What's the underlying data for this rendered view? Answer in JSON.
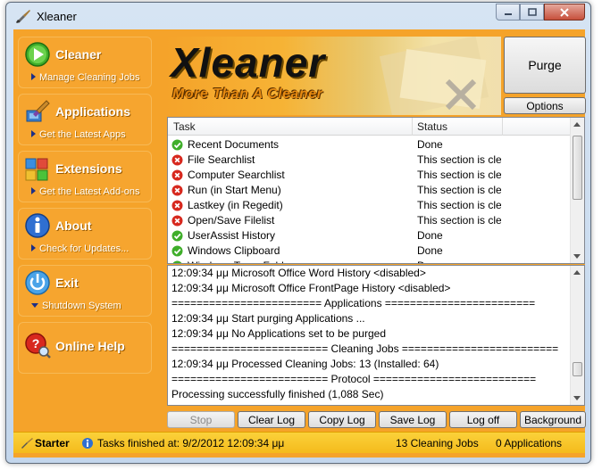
{
  "window": {
    "title": "Xleaner"
  },
  "sidebar": {
    "items": [
      {
        "title": "Cleaner",
        "sub": "Manage Cleaning Jobs",
        "icon": "play-icon"
      },
      {
        "title": "Applications",
        "sub": "Get the Latest Apps",
        "icon": "brush-icon"
      },
      {
        "title": "Extensions",
        "sub": "Get the Latest Add-ons",
        "icon": "cubes-icon"
      },
      {
        "title": "About",
        "sub": "Check for Updates...",
        "icon": "info-icon"
      },
      {
        "title": "Exit",
        "sub": "Shutdown System",
        "icon": "power-icon"
      },
      {
        "title": "Online Help",
        "sub": "",
        "icon": "help-icon"
      }
    ]
  },
  "banner": {
    "title": "Xleaner",
    "subtitle": "More Than A Cleaner"
  },
  "actions": {
    "purge": "Purge",
    "options": "Options"
  },
  "task_table": {
    "columns": [
      "Task",
      "Status"
    ],
    "rows": [
      {
        "task": "Recent Documents",
        "status": "Done",
        "state": "ok"
      },
      {
        "task": "File Searchlist",
        "status": "This section is clear",
        "state": "error"
      },
      {
        "task": "Computer Searchlist",
        "status": "This section is clear",
        "state": "error"
      },
      {
        "task": "Run (in Start Menu)",
        "status": "This section is clear",
        "state": "error"
      },
      {
        "task": "Lastkey (in Regedit)",
        "status": "This section is clear",
        "state": "error"
      },
      {
        "task": "Open/Save Filelist",
        "status": "This section is clear",
        "state": "error"
      },
      {
        "task": "UserAssist History",
        "status": "Done",
        "state": "ok"
      },
      {
        "task": "Windows Clipboard",
        "status": "Done",
        "state": "ok"
      },
      {
        "task": "Windows Temp Folder",
        "status": "Done",
        "state": "ok"
      }
    ]
  },
  "log": {
    "lines": [
      "12:09:34 μμ Microsoft Office Word History <disabled>",
      "12:09:34 μμ Microsoft Office FrontPage History <disabled>",
      "======================== Applications ========================",
      "12:09:34 μμ Start purging Applications ...",
      "12:09:34 μμ No Applications set to be purged",
      "========================= Cleaning Jobs =========================",
      "12:09:34 μμ Processed Cleaning Jobs: 13 (Installed: 64)",
      "========================= Protocol ==========================",
      "Processing successfully finished (1,088 Sec)"
    ]
  },
  "buttons": {
    "stop": "Stop",
    "clear_log": "Clear Log",
    "copy_log": "Copy Log",
    "save_log": "Save Log",
    "log_off": "Log off",
    "background": "Background"
  },
  "status": {
    "mode": "Starter",
    "message": "Tasks finished at: 9/2/2012 12:09:34 μμ",
    "jobs": "13 Cleaning Jobs",
    "apps": "0 Applications"
  },
  "colors": {
    "accent": "#f5a32a",
    "status_bar": "#f8c72a",
    "ok": "#3fae2a",
    "error": "#d7281e"
  }
}
